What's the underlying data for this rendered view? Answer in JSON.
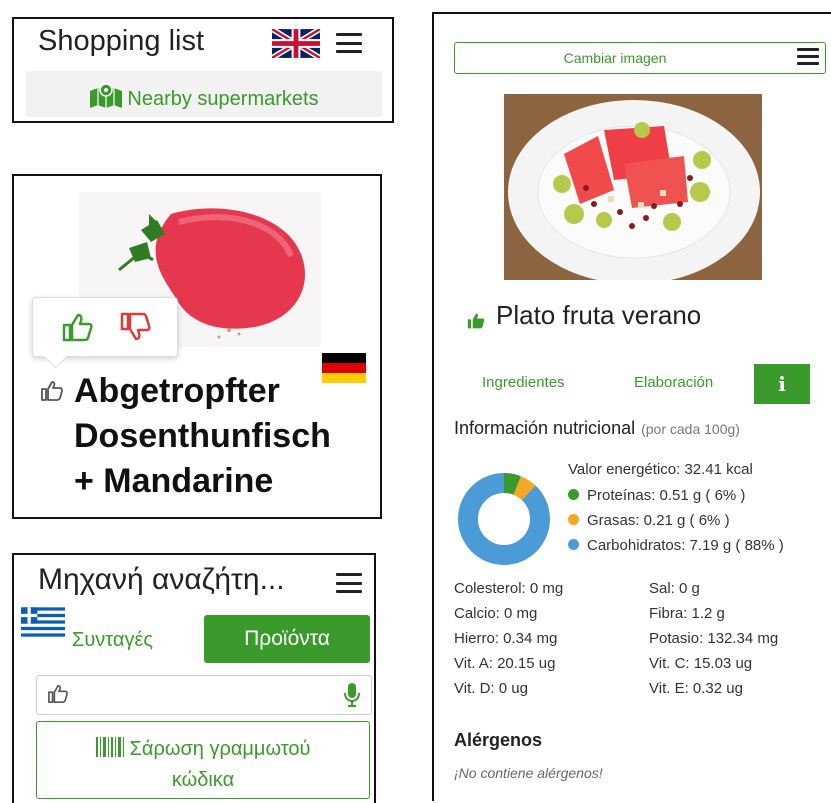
{
  "shopping": {
    "title": "Shopping list",
    "nearby_label": "Nearby supermarkets"
  },
  "product": {
    "name_line1": "Abgetropfter",
    "name_line2": "Dosenthunfisch",
    "name_line3": "+ Mandarine"
  },
  "search": {
    "title": "Μηχανή αναζήτη...",
    "tab_recipes": "Συνταγές",
    "tab_products": "Προϊόντα",
    "scan_line1": "Σάρωση γραμμωτού",
    "scan_line2": "κώδικα"
  },
  "recipe": {
    "change_image": "Cambiar imagen",
    "title": "Plato fruta verano",
    "tab_ingredients": "Ingredientes",
    "tab_elaboration": "Elaboración",
    "tab_info": "i",
    "nutrition_heading": "Información nutricional",
    "nutrition_sub": "(por cada 100g)",
    "energy": "Valor energético: 32.41 kcal",
    "macros": [
      {
        "label": "Proteínas: 0.51 g ( 6% )",
        "color": "#3b9a2c",
        "percent": 6
      },
      {
        "label": "Grasas: 0.21 g ( 6% )",
        "color": "#f5a623",
        "percent": 6
      },
      {
        "label": "Carbohidratos: 7.19 g ( 88% )",
        "color": "#4a9bd6",
        "percent": 88
      }
    ],
    "nutrients_left": [
      "Colesterol: 0 mg",
      "Calcio: 0 mg",
      "Hierro: 0.34 mg",
      "Vit. A: 20.15 ug",
      "Vit. D: 0 ug"
    ],
    "nutrients_right": [
      "Sal: 0 g",
      "Fibra: 1.2 g",
      "Potasio: 132.34 mg",
      "Vit. C: 15.03 ug",
      "Vit. E: 0.32 ug"
    ],
    "allergens_heading": "Alérgenos",
    "allergens_text": "¡No contiene alérgenos!"
  },
  "colors": {
    "accent": "#3b9a2c",
    "protein": "#3b9a2c",
    "fat": "#f5a623",
    "carbs": "#4a9bd6"
  }
}
